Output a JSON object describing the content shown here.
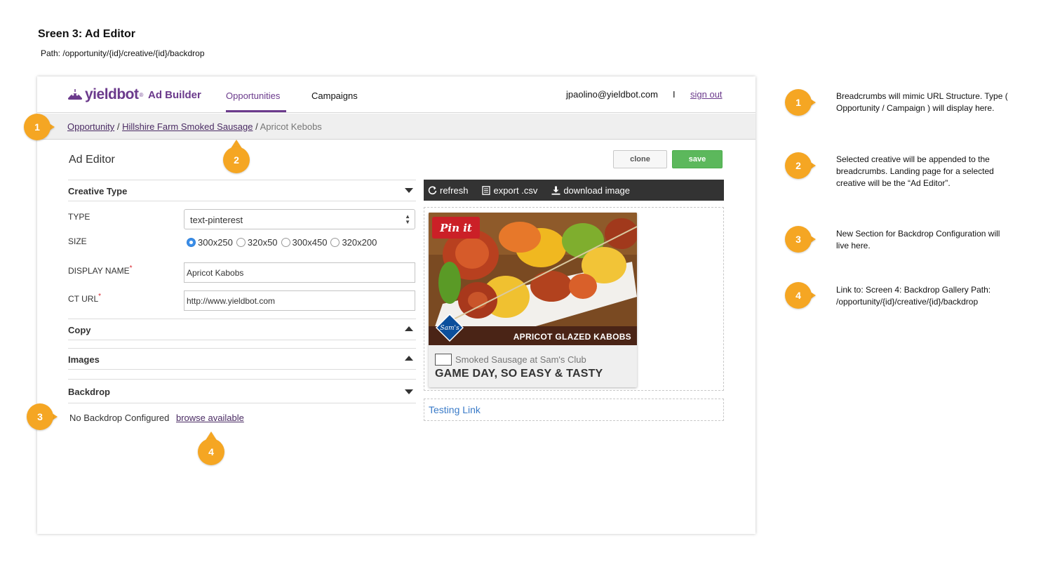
{
  "spec": {
    "title": "Sreen 3: Ad Editor",
    "path": "Path: /opportunity/{id}/creative/{id}/backdrop"
  },
  "header": {
    "brand": "yieldbot",
    "brand_mark": "®",
    "product": "Ad Builder",
    "tabs": [
      {
        "label": "Opportunities",
        "active": true
      },
      {
        "label": "Campaigns",
        "active": false
      }
    ],
    "user_email": "jpaolino@yieldbot.com",
    "separator": "I",
    "sign_out": "sign out",
    "accent_color": "#6b3a8c"
  },
  "breadcrumb": {
    "items": [
      "Opportunity",
      "Hillshire Farm Smoked Sausage"
    ],
    "current": "Apricot Kebobs",
    "divider": "/"
  },
  "editor": {
    "title": "Ad Editor",
    "clone_label": "clone",
    "save_label": "save",
    "sections": {
      "creative_type": "Creative Type",
      "copy": "Copy",
      "images": "Images",
      "backdrop": "Backdrop"
    },
    "fields": {
      "type_label": "TYPE",
      "type_value": "text-pinterest",
      "size_label": "SIZE",
      "sizes": [
        "300x250",
        "320x50",
        "300x450",
        "320x200"
      ],
      "selected_size": "300x250",
      "display_name_label": "DISPLAY NAME",
      "display_name_value": "Apricot Kabobs",
      "ct_url_label": "CT URL",
      "ct_url_value": "http://www.yieldbot.com",
      "required_mark": "*"
    },
    "backdrop": {
      "status": "No Backdrop Configured",
      "link": "browse available"
    }
  },
  "preview": {
    "toolbar": {
      "refresh": "refresh",
      "export": "export .csv",
      "download": "download image"
    },
    "card": {
      "pin_label": "Pin it",
      "caption": "APRICOT GLAZED KABOBS",
      "sponsor": "Smoked Sausage at Sam's Club",
      "headline": "GAME DAY, SO EASY & TASTY",
      "sams_logo": "Sam's"
    },
    "testing_link": "Testing Link"
  },
  "callouts": [
    {
      "number": "1",
      "text": "Breadcrumbs will mimic URL Structure. Type ( Opportunity / Campaign ) will display here."
    },
    {
      "number": "2",
      "text": "Selected creative will be appended to the breadcrumbs. Landing page for a selected creative will be the “Ad Editor”."
    },
    {
      "number": "3",
      "text": "New Section for Backdrop Configuration will live here."
    },
    {
      "number": "4",
      "text": "Link to: Screen 4: Backdrop Gallery Path: /opportunity/{id}/creative/{id}/backdrop"
    }
  ],
  "colors": {
    "callout": "#f5a623",
    "save": "#5cb85c",
    "link_blue": "#3a7bc8",
    "pinterest_red": "#cb2027"
  }
}
